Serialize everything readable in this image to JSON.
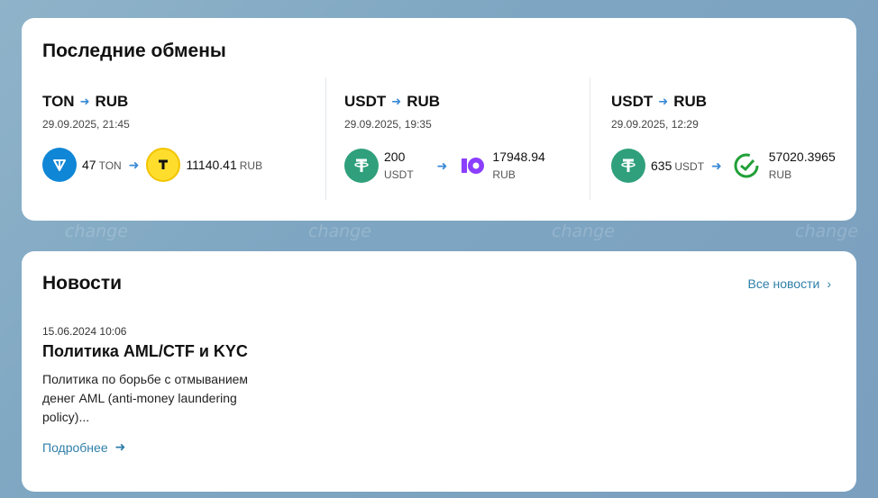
{
  "background": {
    "watermark": "change"
  },
  "exchanges": {
    "title": "Последние обмены",
    "items": [
      {
        "from": "TON",
        "to": "RUB",
        "date": "29.09.2025, 21:45",
        "from_amount": "47",
        "from_currency": "TON",
        "to_amount": "11140.41",
        "to_currency": "RUB",
        "from_icon": "ton-icon",
        "to_icon": "tbank-icon"
      },
      {
        "from": "USDT",
        "to": "RUB",
        "date": "29.09.2025, 19:35",
        "from_amount": "200",
        "from_currency": "USDT",
        "to_amount": "17948.94",
        "to_currency": "RUB",
        "from_icon": "tether-icon",
        "to_icon": "yoomoney-icon"
      },
      {
        "from": "USDT",
        "to": "RUB",
        "date": "29.09.2025, 12:29",
        "from_amount": "635",
        "from_currency": "USDT",
        "to_amount": "57020.3965",
        "to_currency": "RUB",
        "from_icon": "tether-icon",
        "to_icon": "sberbank-icon"
      }
    ]
  },
  "news": {
    "title": "Новости",
    "all_link": "Все новости",
    "item": {
      "date": "15.06.2024 10:06",
      "title": "Политика AML/CTF и KYC",
      "text": "Политика по борьбе с отмыванием денег AML (anti-money laundering policy)...",
      "more_link": "Подробнее"
    }
  },
  "colors": {
    "accent_link": "#2f7fa8",
    "arrow": "#3a8ad6",
    "ton": "#0f86d6",
    "tether": "#2fa07b",
    "tbank": "#ffdd2d",
    "yoomoney": "#8b3ffd",
    "sber": "#21a038"
  }
}
